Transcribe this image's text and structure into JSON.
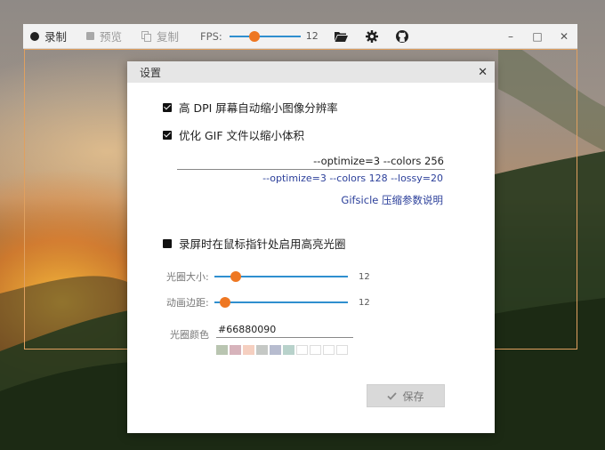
{
  "toolbar": {
    "record_label": "录制",
    "preview_label": "预览",
    "copy_label": "复制",
    "fps_label": "FPS:",
    "fps_value": "12",
    "fps_slider_fraction": 0.35
  },
  "window_controls": {
    "minimize": "–",
    "maximize": "□",
    "close": "✕"
  },
  "dialog": {
    "title": "设置",
    "close": "✕",
    "option_high_dpi": {
      "label": "高 DPI 屏幕自动缩小图像分辨率",
      "checked": true
    },
    "option_optimize_gif": {
      "label": "优化 GIF 文件以缩小体积",
      "checked": true
    },
    "optimize_args_value": "--optimize=3 --colors 256",
    "preset_1": "--optimize=3 --colors 128 --lossy=20",
    "gifsicle_help": "Gifsicle 压缩参数说明",
    "option_cursor_halo": {
      "label": "录屏时在鼠标指针处启用高亮光圈",
      "checked": false
    },
    "halo_size": {
      "label": "光圈大小:",
      "value": "12",
      "fraction": 0.16
    },
    "anim_margin": {
      "label": "动画边距:",
      "value": "12",
      "fraction": 0.08
    },
    "halo_color_label": "光圈颜色",
    "halo_color_value": "#66880090",
    "swatch_colors": [
      "#b9c5b1",
      "#d7b3bb",
      "#f5cfc0",
      "#c5c8c5",
      "#b7bccf",
      "#b8d2cb",
      "#ffffff",
      "#ffffff",
      "#ffffff",
      "#ffffff"
    ],
    "save_label": "保存"
  },
  "colors": {
    "accent": "#ee7722",
    "slider_track": "#2f8fcf",
    "link": "#2b3f9a"
  }
}
